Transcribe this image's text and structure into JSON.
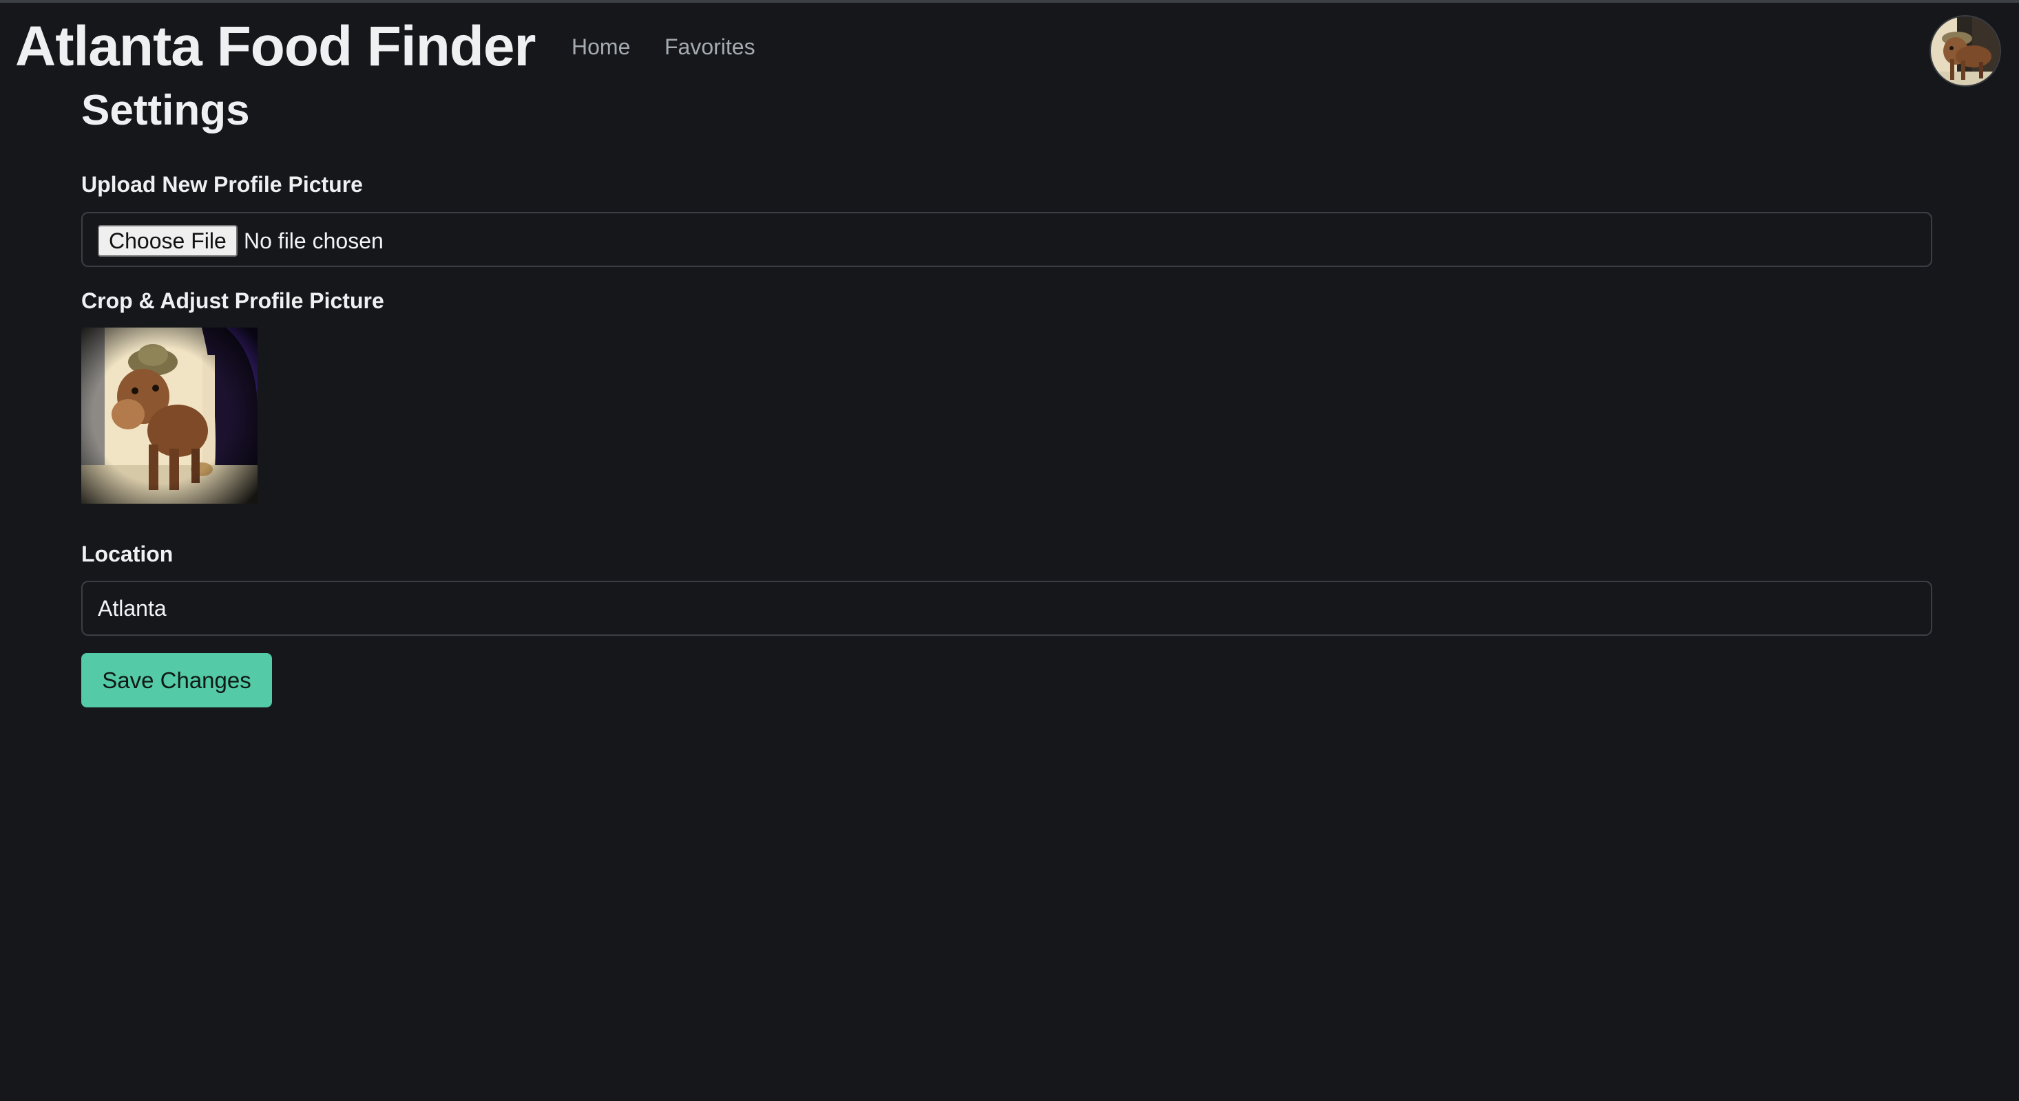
{
  "navbar": {
    "brand": "Atlanta Food Finder",
    "links": [
      {
        "label": "Home"
      },
      {
        "label": "Favorites"
      }
    ],
    "avatar_icon": "profile-avatar-horse"
  },
  "page": {
    "title": "Settings"
  },
  "form": {
    "upload_label": "Upload New Profile Picture",
    "file_button_label": "Choose File",
    "file_status": "No file chosen",
    "crop_label": "Crop & Adjust Profile Picture",
    "location_label": "Location",
    "location_value": "Atlanta",
    "save_label": "Save Changes"
  },
  "colors": {
    "background": "#15171b",
    "accent": "#54caa6",
    "muted_text": "#a6abb2"
  }
}
